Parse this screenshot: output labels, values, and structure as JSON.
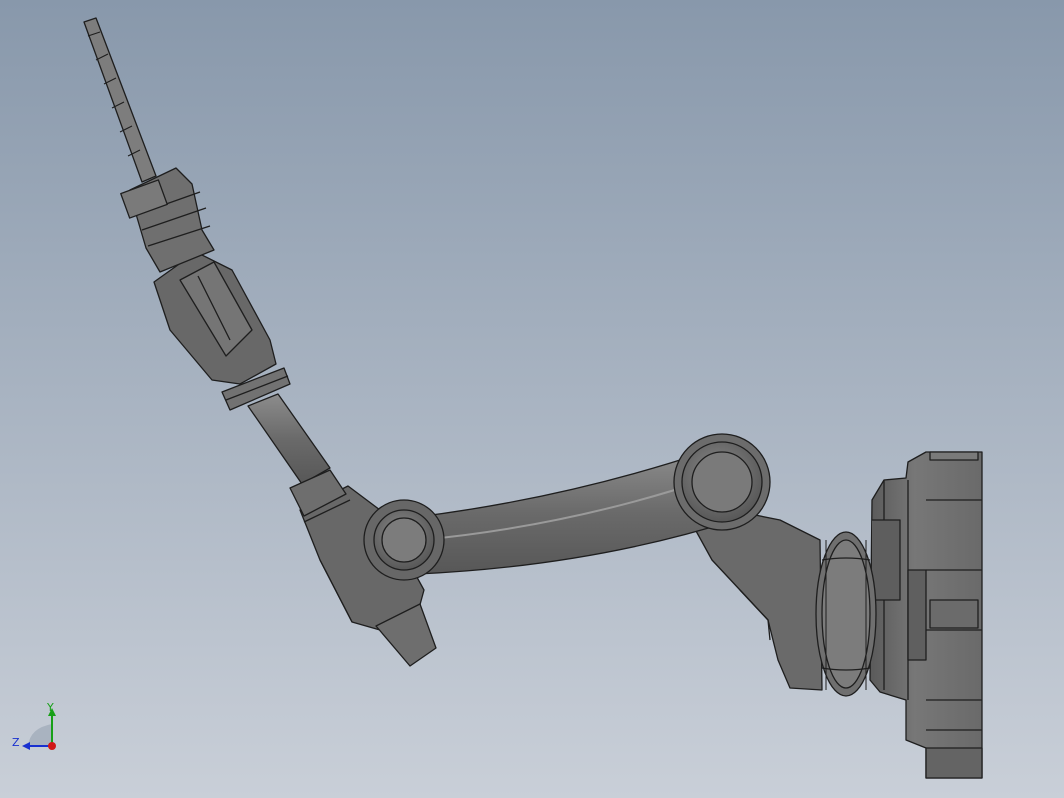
{
  "viewport": {
    "background_top": "#8898ab",
    "background_bottom": "#c9cfd8"
  },
  "model": {
    "body_color": "#6e6e6e",
    "edge_color": "#1e1e1e",
    "highlight_color": "#9a9a9a"
  },
  "triad": {
    "y_label": "Y",
    "z_label": "Z",
    "x_color": "#d01818",
    "y_color": "#18a018",
    "z_color": "#1830d0"
  }
}
